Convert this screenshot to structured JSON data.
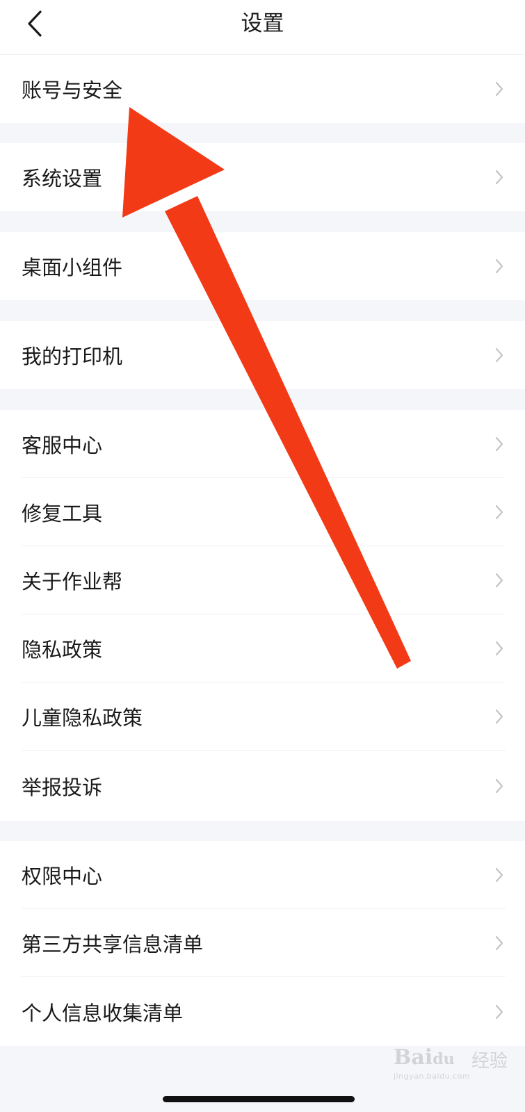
{
  "header": {
    "title": "设置",
    "back_icon": "chevron-left-icon"
  },
  "groups": [
    {
      "items": [
        {
          "label": "账号与安全"
        }
      ]
    },
    {
      "items": [
        {
          "label": "系统设置"
        }
      ]
    },
    {
      "items": [
        {
          "label": "桌面小组件"
        }
      ]
    },
    {
      "items": [
        {
          "label": "我的打印机"
        }
      ]
    },
    {
      "items": [
        {
          "label": "客服中心"
        },
        {
          "label": "修复工具"
        },
        {
          "label": "关于作业帮"
        },
        {
          "label": "隐私政策"
        },
        {
          "label": "儿童隐私政策"
        },
        {
          "label": "举报投诉"
        }
      ]
    },
    {
      "items": [
        {
          "label": "权限中心"
        },
        {
          "label": "第三方共享信息清单"
        },
        {
          "label": "个人信息收集清单"
        }
      ]
    }
  ],
  "row_icon": "chevron-right-icon",
  "annotation": {
    "icon": "red-arrow-annotation",
    "color": "#f33a17"
  },
  "watermark": {
    "logo": "Bai经验",
    "brand": "经验",
    "url": "jingyan.baidu.com"
  },
  "colors": {
    "background": "#ffffff",
    "separator": "#f5f6f9",
    "text": "#1a1a1a",
    "chevron": "#c4c4c8"
  }
}
